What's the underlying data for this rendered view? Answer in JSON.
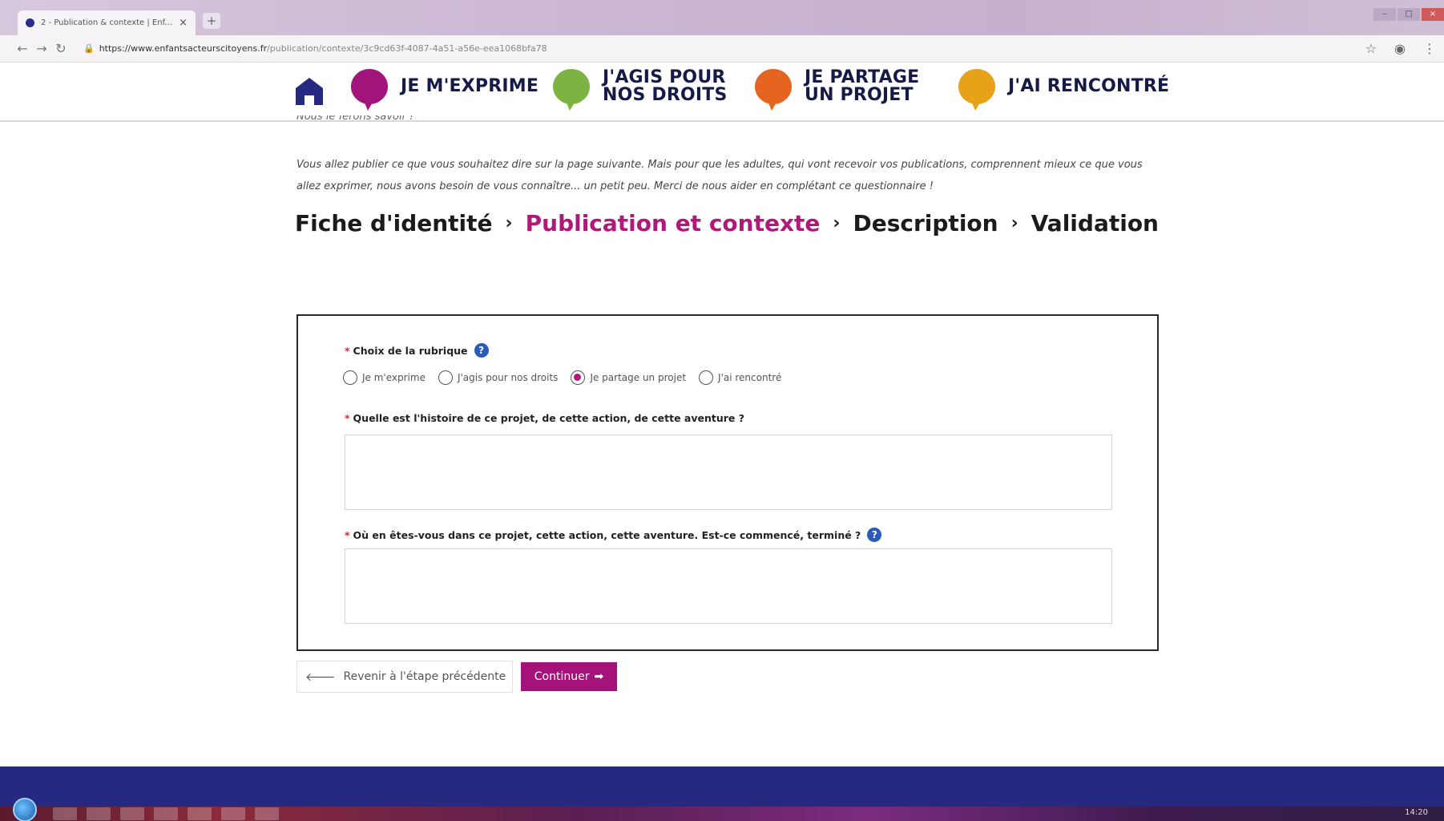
{
  "browser": {
    "tab_title": "2 - Publication & contexte | Enf...",
    "tab_close": "×",
    "new_tab": "+",
    "window_title": "",
    "url_host": "https://www.enfantsacteurscitoyens.fr",
    "url_path": "/publication/contexte/3c9cd63f-4087-4a51-a56e-eea1068bfa78",
    "icons": [
      "back-icon",
      "forward-icon",
      "reload-icon",
      "lock-icon",
      "star-icon",
      "account-icon",
      "menu-icon"
    ]
  },
  "header": {
    "menu": [
      {
        "line1": "JE M'EXPRIME",
        "line2": "",
        "color": "#a3137c"
      },
      {
        "line1": "J'AGIS POUR",
        "line2": "NOS DROITS",
        "color": "#7cb342"
      },
      {
        "line1": "JE PARTAGE",
        "line2": "UN PROJET",
        "color": "#e5641f"
      },
      {
        "line1": "J'AI RENCONTRÉ",
        "line2": "",
        "color": "#e8a21a"
      }
    ],
    "home_color": "#252a80"
  },
  "content": {
    "cutoff_text": "Nous le ferons savoir !",
    "intro": "Vous allez publier ce que vous souhaitez dire sur la page suivante. Mais pour que les adultes, qui vont recevoir vos publications, comprennent mieux ce que vous allez exprimer, nous avons besoin de vous connaître... un petit peu. Merci de nous aider en complétant ce questionnaire !",
    "steps": [
      {
        "label": "Fiche d'identité",
        "active": false
      },
      {
        "label": "Publication et contexte",
        "active": true
      },
      {
        "label": "Description",
        "active": false
      },
      {
        "label": "Validation",
        "active": false
      }
    ],
    "step_separator": "›"
  },
  "form": {
    "required_mark": "*",
    "rubrique_label": "Choix de la rubrique",
    "rubrique_options": [
      "Je m'exprime",
      "J'agis pour nos droits",
      "Je partage un projet",
      "J'ai rencontré"
    ],
    "rubrique_selected": "Je partage un projet",
    "histoire_label": "Quelle est l'histoire de ce projet, de cette action, de cette aventure ?",
    "histoire_value": "",
    "avancement_label": "Où en êtes-vous dans ce projet, cette action, cette aventure. Est-ce commencé, terminé ?",
    "avancement_value": "",
    "help_glyph": "?"
  },
  "actions": {
    "back_label": "Revenir à l'étape précédente",
    "back_arrow": "🡐",
    "next_label": "Continuer",
    "next_arrow": "➡",
    "accent": "#a4127a"
  },
  "taskbar": {
    "clock": "14:20"
  }
}
